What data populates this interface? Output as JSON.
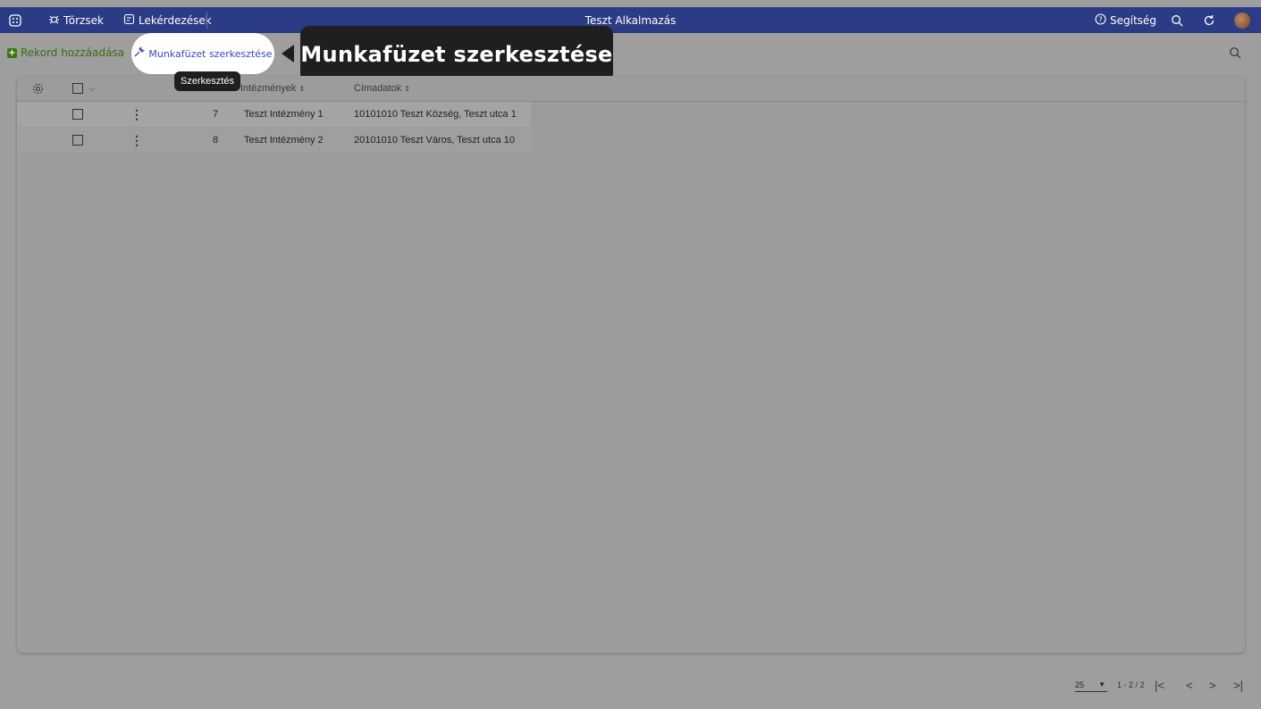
{
  "topbar": {
    "apps_icon": "apps-grid-icon",
    "nav": [
      {
        "label": "Törzsek",
        "icon": "bug-icon"
      },
      {
        "label": "Lekérdezések",
        "icon": "query-icon"
      }
    ],
    "app_title": "Teszt Alkalmazás",
    "help_label": "Segítség",
    "search_icon": "search-icon",
    "refresh_icon": "refresh-icon",
    "avatar": "user-avatar",
    "bg_color": "#2c3b85"
  },
  "toolbar": {
    "add_label": "Rekord hozzáadása",
    "edit_label": "Munkafüzet szerkesztése",
    "callout_text": "Munkafüzet szerkesztése",
    "tooltip_text": "Szerkesztés",
    "search_icon": "search-icon"
  },
  "table": {
    "columns": [
      "Intézmények",
      "Címadatok"
    ],
    "rows": [
      {
        "id": "7",
        "name": "Teszt Intézmény 1",
        "address": "10101010 Teszt Község, Teszt utca 1"
      },
      {
        "id": "8",
        "name": "Teszt Intézmény 2",
        "address": "20101010 Teszt Város, Teszt utca 10"
      }
    ]
  },
  "footer": {
    "page_size": "25",
    "range": "1 - 2 / 2"
  }
}
